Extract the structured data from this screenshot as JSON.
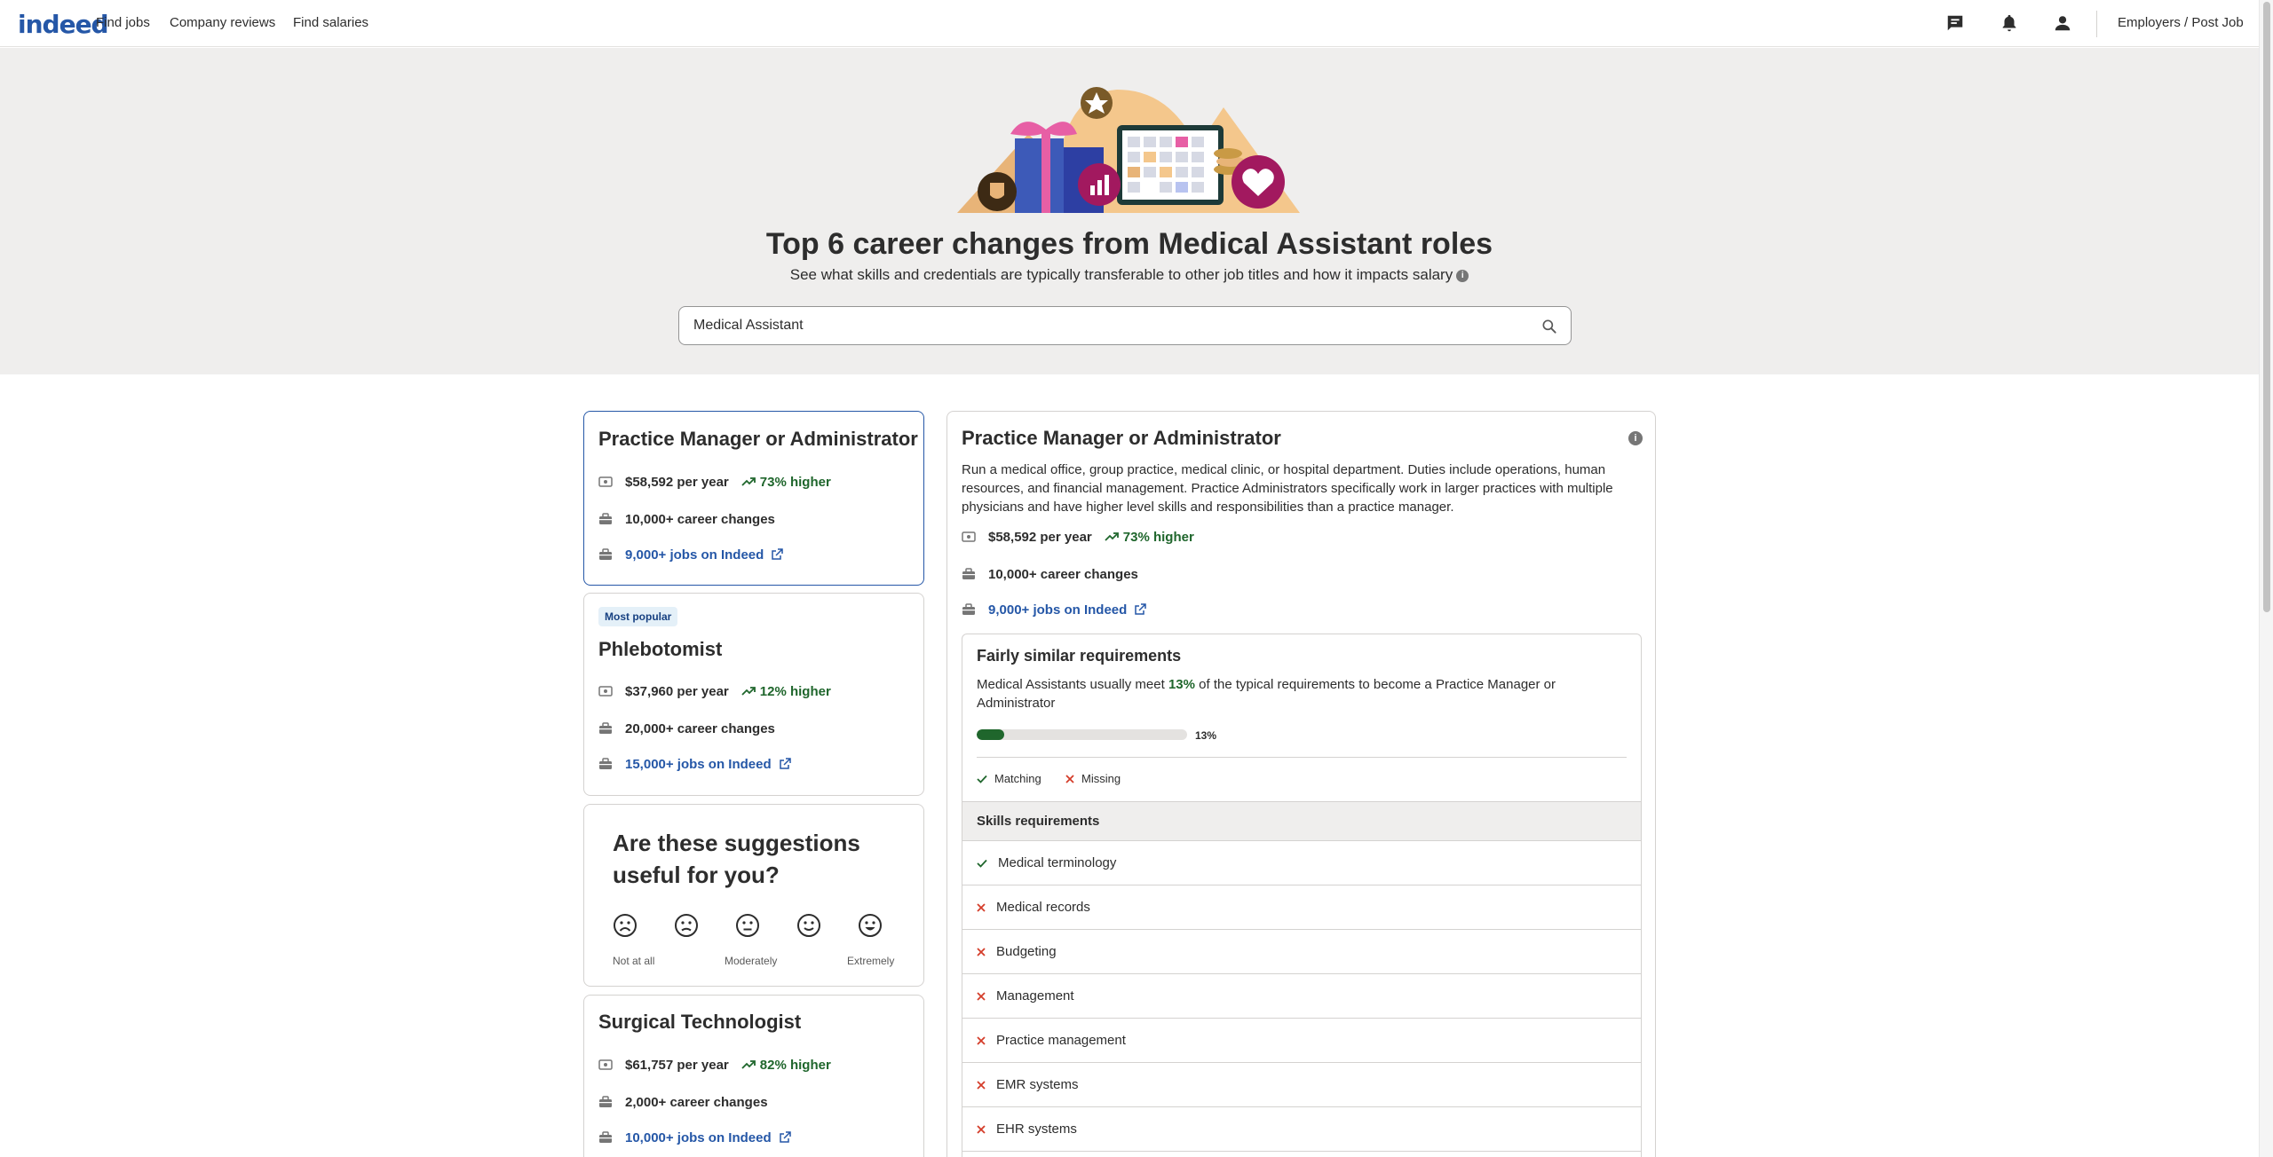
{
  "header": {
    "logo": "indeed",
    "nav": [
      "Find jobs",
      "Company reviews",
      "Find salaries"
    ],
    "employers_link": "Employers / Post Job",
    "icons": [
      "messages-icon",
      "notifications-icon",
      "account-icon"
    ]
  },
  "hero": {
    "title": "Top 6 career changes from Medical Assistant roles",
    "subtitle": "See what skills and credentials are typically transferable to other job titles and how it impacts salary",
    "search_value": "Medical Assistant"
  },
  "cards": [
    {
      "title": "Practice Manager or Administrator",
      "salary": "$58,592 per year",
      "higher": "73% higher",
      "career_changes": "10,000+ career changes",
      "jobs": "9,000+ jobs on Indeed"
    },
    {
      "badge": "Most popular",
      "title": "Phlebotomist",
      "salary": "$37,960 per year",
      "higher": "12% higher",
      "career_changes": "20,000+ career changes",
      "jobs": "15,000+ jobs on Indeed"
    },
    {
      "title": "Surgical Technologist",
      "salary": "$61,757 per year",
      "higher": "82% higher",
      "career_changes": "2,000+ career changes",
      "jobs": "10,000+ jobs on Indeed"
    }
  ],
  "feedback": {
    "title": "Are these suggestions useful for you?",
    "labels": [
      "Not at all",
      "Moderately",
      "Extremely"
    ]
  },
  "detail": {
    "title": "Practice Manager or Administrator",
    "description": "Run a medical office, group practice, medical clinic, or hospital department. Duties include operations, human resources, and financial management. Practice Administrators specifically work in larger practices with multiple physicians and have higher level skills and responsibilities than a practice manager.",
    "salary": "$58,592 per year",
    "higher": "73% higher",
    "career_changes": "10,000+ career changes",
    "jobs": "9,000+ jobs on Indeed",
    "requirements": {
      "title": "Fairly similar requirements",
      "text_before": "Medical Assistants usually meet ",
      "percent": "13%",
      "text_after": " of the typical requirements to become a Practice Manager or Administrator",
      "match_fraction": 0.13,
      "bar_label": "13%",
      "legend_matching": "Matching",
      "legend_missing": "Missing",
      "skills_header": "Skills requirements",
      "skills": [
        {
          "name": "Medical terminology",
          "status": "matching"
        },
        {
          "name": "Medical records",
          "status": "missing"
        },
        {
          "name": "Budgeting",
          "status": "missing"
        },
        {
          "name": "Management",
          "status": "missing"
        },
        {
          "name": "Practice management",
          "status": "missing"
        },
        {
          "name": "EMR systems",
          "status": "missing"
        },
        {
          "name": "EHR systems",
          "status": "missing"
        }
      ]
    }
  },
  "colors": {
    "brand_blue": "#2557a7",
    "positive_green": "#1f662c",
    "missing_red": "#d43d2a",
    "hero_bg": "#efeeed"
  }
}
